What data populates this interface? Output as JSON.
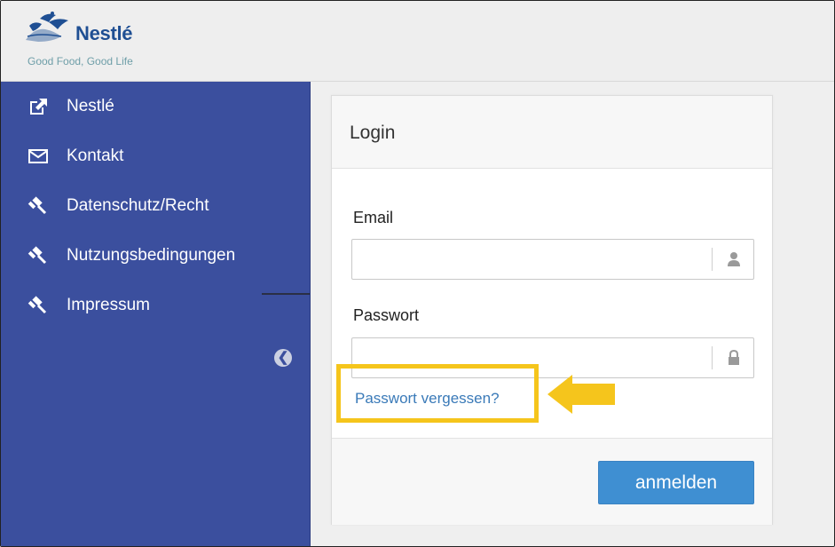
{
  "header": {
    "brand": "Nestlé",
    "tagline": "Good Food, Good Life"
  },
  "sidebar": {
    "items": [
      {
        "label": "Nestlé",
        "icon": "external-link-icon"
      },
      {
        "label": "Kontakt",
        "icon": "envelope-icon"
      },
      {
        "label": "Datenschutz/Recht",
        "icon": "gavel-icon"
      },
      {
        "label": "Nutzungsbedingungen",
        "icon": "gavel-icon"
      },
      {
        "label": "Impressum",
        "icon": "gavel-icon"
      }
    ],
    "collapse_icon": "arrow-circle-left-icon"
  },
  "login": {
    "title": "Login",
    "email_label": "Email",
    "email_value": "",
    "email_icon": "user-icon",
    "password_label": "Passwort",
    "password_value": "",
    "password_icon": "lock-icon",
    "forgot_link": "Passwort vergessen?",
    "submit_label": "anmelden"
  },
  "annotation": {
    "highlight_color": "#f5c51c",
    "arrow_icon": "arrow-left-icon"
  },
  "colors": {
    "sidebar": "#3b4f9e",
    "button": "#3f8fd2",
    "link": "#3a7ab8",
    "brand": "#1f4f93"
  }
}
